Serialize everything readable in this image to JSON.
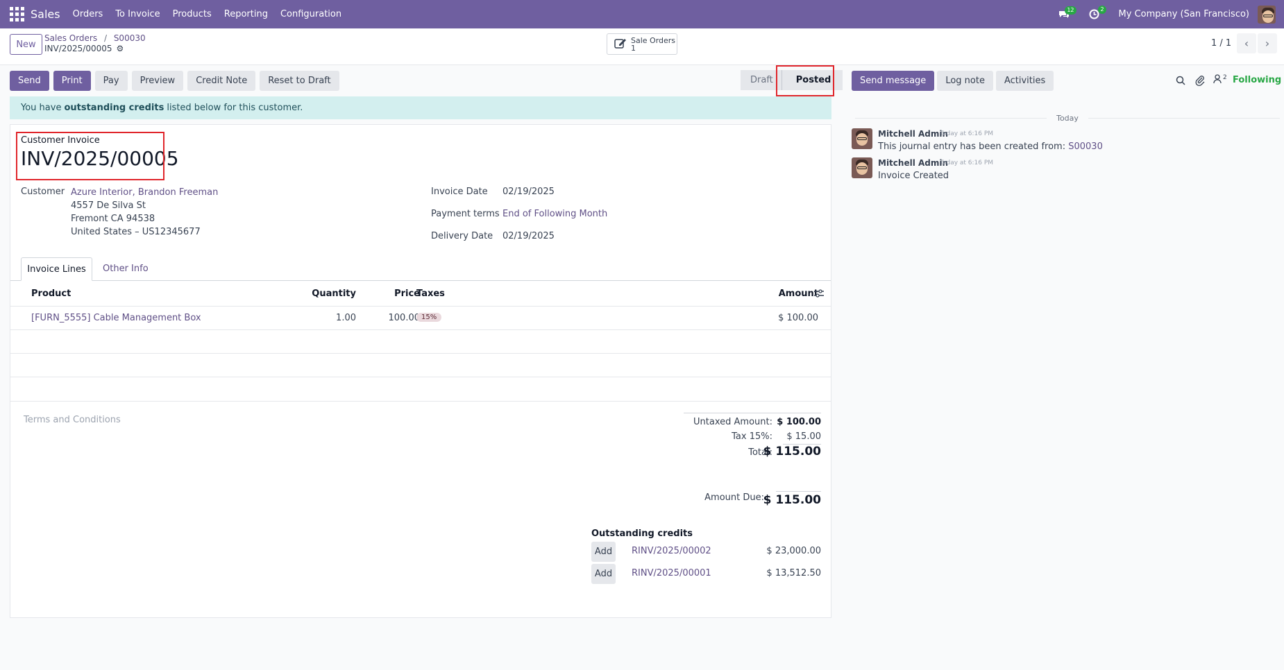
{
  "topbar": {
    "app_name": "Sales",
    "menu": [
      "Orders",
      "To Invoice",
      "Products",
      "Reporting",
      "Configuration"
    ],
    "messages_count": "12",
    "activities_count": "2",
    "company": "My Company (San Francisco)"
  },
  "control_panel": {
    "new_label": "New",
    "breadcrumb_parent": "Sales Orders",
    "breadcrumb_sep": "/",
    "breadcrumb_order": "S00030",
    "record_name": "INV/2025/00005",
    "smart_button_label": "Sale Orders",
    "smart_button_count": "1",
    "pager": "1 / 1"
  },
  "actions": {
    "send": "Send",
    "print": "Print",
    "pay": "Pay",
    "preview": "Preview",
    "credit_note": "Credit Note",
    "reset_to_draft": "Reset to Draft"
  },
  "status": {
    "draft": "Draft",
    "posted": "Posted"
  },
  "alert": {
    "prefix": "You have",
    "bold": "outstanding credits",
    "suffix": "listed below for this customer."
  },
  "invoice": {
    "type_label": "Customer Invoice",
    "number": "INV/2025/00005",
    "customer_label": "Customer",
    "customer_name": "Azure Interior, Brandon Freeman",
    "address_line1": "4557 De Silva St",
    "address_line2": "Fremont CA 94538",
    "address_line3": "United States – US12345677",
    "invoice_date_label": "Invoice Date",
    "invoice_date": "02/19/2025",
    "payment_terms_label": "Payment terms",
    "payment_terms": "End of Following Month",
    "delivery_date_label": "Delivery Date",
    "delivery_date": "02/19/2025"
  },
  "tabs": {
    "invoice_lines": "Invoice Lines",
    "other_info": "Other Info"
  },
  "lines": {
    "headers": {
      "product": "Product",
      "quantity": "Quantity",
      "price": "Price",
      "taxes": "Taxes",
      "amount": "Amount"
    },
    "rows": [
      {
        "product": "[FURN_5555] Cable Management Box",
        "quantity": "1.00",
        "price": "100.00",
        "tax": "15%",
        "amount": "$ 100.00"
      }
    ]
  },
  "terms_placeholder": "Terms and Conditions",
  "totals": {
    "untaxed_label": "Untaxed Amount:",
    "untaxed": "$ 100.00",
    "tax_label": "Tax 15%:",
    "tax": "$ 15.00",
    "total_label": "Total:",
    "total": "$ 115.00",
    "amount_due_label": "Amount Due:",
    "amount_due": "$ 115.00"
  },
  "outstanding": {
    "title": "Outstanding credits",
    "items": [
      {
        "add": "Add",
        "ref": "RINV/2025/00002",
        "amount": "$ 23,000.00"
      },
      {
        "add": "Add",
        "ref": "RINV/2025/00001",
        "amount": "$ 13,512.50"
      }
    ]
  },
  "chatter": {
    "send_message": "Send message",
    "log_note": "Log note",
    "activities": "Activities",
    "followers_count": "2",
    "following": "Following",
    "date_separator": "Today",
    "messages": [
      {
        "author": "Mitchell Admin",
        "time": "Today at 6:16 PM",
        "text": "This journal entry has been created from:",
        "link": "S00030"
      },
      {
        "author": "Mitchell Admin",
        "time": "Today at 6:16 PM",
        "text": "Invoice Created",
        "link": ""
      }
    ]
  },
  "colors": {
    "brand": "#6f5fa0",
    "alert_bg": "#d3efef",
    "highlight": "#e0252b",
    "following": "#28a745"
  }
}
